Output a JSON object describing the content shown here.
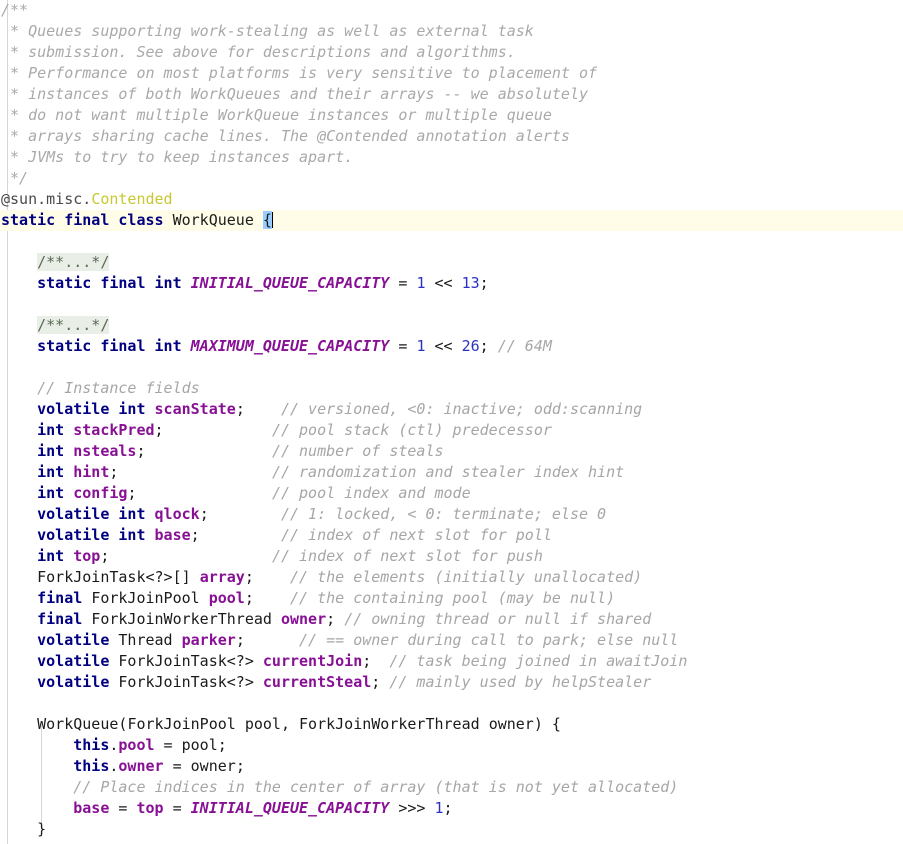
{
  "editor": {
    "language": "java",
    "theme": "light",
    "colors": {
      "background": "#ffffff",
      "current_line_highlight": "#fffce8",
      "keyword": "#000080",
      "field": "#871094",
      "constant": "#871094",
      "number": "#2a31c4",
      "comment": "#a6a6a6",
      "annotation_name": "#c8c832",
      "folded_region_bg": "#e9eee7",
      "matched_brace_bg": "#99ccff",
      "indent_guide": "#d6d6d6"
    },
    "caret_line_index": 9
  },
  "lines": [
    {
      "id": "line-1",
      "kind": "javadoc",
      "tokens": [
        {
          "cls": "jdoc",
          "t": "/**"
        }
      ]
    },
    {
      "id": "line-2",
      "kind": "javadoc",
      "tokens": [
        {
          "cls": "jdoc",
          "t": " * Queues supporting work-stealing as well as external task"
        }
      ]
    },
    {
      "id": "line-3",
      "kind": "javadoc",
      "tokens": [
        {
          "cls": "jdoc",
          "t": " * submission. See above for descriptions and algorithms."
        }
      ]
    },
    {
      "id": "line-4",
      "kind": "javadoc",
      "tokens": [
        {
          "cls": "jdoc",
          "t": " * Performance on most platforms is very sensitive to placement of"
        }
      ]
    },
    {
      "id": "line-5",
      "kind": "javadoc",
      "tokens": [
        {
          "cls": "jdoc",
          "t": " * instances of both WorkQueues and their arrays -- we absolutely"
        }
      ]
    },
    {
      "id": "line-6",
      "kind": "javadoc",
      "tokens": [
        {
          "cls": "jdoc",
          "t": " * do not want multiple WorkQueue instances or multiple queue"
        }
      ]
    },
    {
      "id": "line-7",
      "kind": "javadoc",
      "tokens": [
        {
          "cls": "jdoc",
          "t": " * arrays sharing cache lines. The @Contended annotation alerts"
        }
      ]
    },
    {
      "id": "line-8",
      "kind": "javadoc",
      "tokens": [
        {
          "cls": "jdoc",
          "t": " * JVMs to try to keep instances apart."
        }
      ]
    },
    {
      "id": "line-9",
      "kind": "javadoc",
      "tokens": [
        {
          "cls": "jdoc",
          "t": " */"
        }
      ]
    },
    {
      "id": "line-10",
      "kind": "annotation",
      "tokens": [
        {
          "cls": "anno",
          "t": "@sun.misc."
        },
        {
          "cls": "anno-name",
          "t": "Contended"
        }
      ]
    },
    {
      "id": "line-11",
      "kind": "class-declaration",
      "current": true,
      "tokens": [
        {
          "cls": "kw",
          "t": "static final class"
        },
        {
          "cls": "plain",
          "t": " "
        },
        {
          "cls": "type",
          "t": "WorkQueue"
        },
        {
          "cls": "plain",
          "t": " "
        },
        {
          "cls": "brace-hl",
          "t": "{"
        },
        {
          "cls": "caret",
          "t": ""
        }
      ]
    },
    {
      "id": "line-12",
      "kind": "blank",
      "tokens": [
        {
          "cls": "plain",
          "t": ""
        }
      ]
    },
    {
      "id": "line-13",
      "kind": "folded-javadoc",
      "tokens": [
        {
          "cls": "plain",
          "t": "    "
        },
        {
          "cls": "fold",
          "t": "/**...*/"
        }
      ]
    },
    {
      "id": "line-14",
      "kind": "constant-declaration",
      "tokens": [
        {
          "cls": "plain",
          "t": "    "
        },
        {
          "cls": "kw",
          "t": "static final int"
        },
        {
          "cls": "plain",
          "t": " "
        },
        {
          "cls": "constant",
          "t": "INITIAL_QUEUE_CAPACITY"
        },
        {
          "cls": "op",
          "t": " = "
        },
        {
          "cls": "num",
          "t": "1"
        },
        {
          "cls": "op",
          "t": " << "
        },
        {
          "cls": "num",
          "t": "13"
        },
        {
          "cls": "op",
          "t": ";"
        }
      ]
    },
    {
      "id": "line-15",
      "kind": "blank",
      "tokens": [
        {
          "cls": "plain",
          "t": ""
        }
      ]
    },
    {
      "id": "line-16",
      "kind": "folded-javadoc",
      "tokens": [
        {
          "cls": "plain",
          "t": "    "
        },
        {
          "cls": "fold",
          "t": "/**...*/"
        }
      ]
    },
    {
      "id": "line-17",
      "kind": "constant-declaration",
      "tokens": [
        {
          "cls": "plain",
          "t": "    "
        },
        {
          "cls": "kw",
          "t": "static final int"
        },
        {
          "cls": "plain",
          "t": " "
        },
        {
          "cls": "constant",
          "t": "MAXIMUM_QUEUE_CAPACITY"
        },
        {
          "cls": "op",
          "t": " = "
        },
        {
          "cls": "num",
          "t": "1"
        },
        {
          "cls": "op",
          "t": " << "
        },
        {
          "cls": "num",
          "t": "26"
        },
        {
          "cls": "op",
          "t": ";"
        },
        {
          "cls": "comment",
          "t": " // 64M"
        }
      ]
    },
    {
      "id": "line-18",
      "kind": "blank",
      "tokens": [
        {
          "cls": "plain",
          "t": ""
        }
      ]
    },
    {
      "id": "line-19",
      "kind": "comment",
      "tokens": [
        {
          "cls": "plain",
          "t": "    "
        },
        {
          "cls": "comment",
          "t": "// Instance fields"
        }
      ]
    },
    {
      "id": "line-20",
      "kind": "field-declaration",
      "tokens": [
        {
          "cls": "plain",
          "t": "    "
        },
        {
          "cls": "kw",
          "t": "volatile int"
        },
        {
          "cls": "plain",
          "t": " "
        },
        {
          "cls": "field",
          "t": "scanState"
        },
        {
          "cls": "op",
          "t": ";"
        },
        {
          "cls": "plain",
          "t": "    "
        },
        {
          "cls": "comment",
          "t": "// versioned, <0: inactive; odd:scanning"
        }
      ]
    },
    {
      "id": "line-21",
      "kind": "field-declaration",
      "tokens": [
        {
          "cls": "plain",
          "t": "    "
        },
        {
          "cls": "kw",
          "t": "int"
        },
        {
          "cls": "plain",
          "t": " "
        },
        {
          "cls": "field",
          "t": "stackPred"
        },
        {
          "cls": "op",
          "t": ";"
        },
        {
          "cls": "plain",
          "t": "            "
        },
        {
          "cls": "comment",
          "t": "// pool stack (ctl) predecessor"
        }
      ]
    },
    {
      "id": "line-22",
      "kind": "field-declaration",
      "tokens": [
        {
          "cls": "plain",
          "t": "    "
        },
        {
          "cls": "kw",
          "t": "int"
        },
        {
          "cls": "plain",
          "t": " "
        },
        {
          "cls": "field",
          "t": "nsteals"
        },
        {
          "cls": "op",
          "t": ";"
        },
        {
          "cls": "plain",
          "t": "              "
        },
        {
          "cls": "comment",
          "t": "// number of steals"
        }
      ]
    },
    {
      "id": "line-23",
      "kind": "field-declaration",
      "tokens": [
        {
          "cls": "plain",
          "t": "    "
        },
        {
          "cls": "kw",
          "t": "int"
        },
        {
          "cls": "plain",
          "t": " "
        },
        {
          "cls": "field",
          "t": "hint"
        },
        {
          "cls": "op",
          "t": ";"
        },
        {
          "cls": "plain",
          "t": "                 "
        },
        {
          "cls": "comment",
          "t": "// randomization and stealer index hint"
        }
      ]
    },
    {
      "id": "line-24",
      "kind": "field-declaration",
      "tokens": [
        {
          "cls": "plain",
          "t": "    "
        },
        {
          "cls": "kw",
          "t": "int"
        },
        {
          "cls": "plain",
          "t": " "
        },
        {
          "cls": "field",
          "t": "config"
        },
        {
          "cls": "op",
          "t": ";"
        },
        {
          "cls": "plain",
          "t": "               "
        },
        {
          "cls": "comment",
          "t": "// pool index and mode"
        }
      ]
    },
    {
      "id": "line-25",
      "kind": "field-declaration",
      "tokens": [
        {
          "cls": "plain",
          "t": "    "
        },
        {
          "cls": "kw",
          "t": "volatile int"
        },
        {
          "cls": "plain",
          "t": " "
        },
        {
          "cls": "field",
          "t": "qlock"
        },
        {
          "cls": "op",
          "t": ";"
        },
        {
          "cls": "plain",
          "t": "        "
        },
        {
          "cls": "comment",
          "t": "// 1: locked, < 0: terminate; else 0"
        }
      ]
    },
    {
      "id": "line-26",
      "kind": "field-declaration",
      "tokens": [
        {
          "cls": "plain",
          "t": "    "
        },
        {
          "cls": "kw",
          "t": "volatile int"
        },
        {
          "cls": "plain",
          "t": " "
        },
        {
          "cls": "field",
          "t": "base"
        },
        {
          "cls": "op",
          "t": ";"
        },
        {
          "cls": "plain",
          "t": "         "
        },
        {
          "cls": "comment",
          "t": "// index of next slot for poll"
        }
      ]
    },
    {
      "id": "line-27",
      "kind": "field-declaration",
      "tokens": [
        {
          "cls": "plain",
          "t": "    "
        },
        {
          "cls": "kw",
          "t": "int"
        },
        {
          "cls": "plain",
          "t": " "
        },
        {
          "cls": "field",
          "t": "top"
        },
        {
          "cls": "op",
          "t": ";"
        },
        {
          "cls": "plain",
          "t": "                  "
        },
        {
          "cls": "comment",
          "t": "// index of next slot for push"
        }
      ]
    },
    {
      "id": "line-28",
      "kind": "field-declaration",
      "tokens": [
        {
          "cls": "plain",
          "t": "    "
        },
        {
          "cls": "type",
          "t": "ForkJoinTask<?>[]"
        },
        {
          "cls": "plain",
          "t": " "
        },
        {
          "cls": "field",
          "t": "array"
        },
        {
          "cls": "op",
          "t": ";"
        },
        {
          "cls": "plain",
          "t": "    "
        },
        {
          "cls": "comment",
          "t": "// the elements (initially unallocated)"
        }
      ]
    },
    {
      "id": "line-29",
      "kind": "field-declaration",
      "tokens": [
        {
          "cls": "plain",
          "t": "    "
        },
        {
          "cls": "kw",
          "t": "final"
        },
        {
          "cls": "plain",
          "t": " "
        },
        {
          "cls": "type",
          "t": "ForkJoinPool"
        },
        {
          "cls": "plain",
          "t": " "
        },
        {
          "cls": "field",
          "t": "pool"
        },
        {
          "cls": "op",
          "t": ";"
        },
        {
          "cls": "plain",
          "t": "    "
        },
        {
          "cls": "comment",
          "t": "// the containing pool (may be null)"
        }
      ]
    },
    {
      "id": "line-30",
      "kind": "field-declaration",
      "tokens": [
        {
          "cls": "plain",
          "t": "    "
        },
        {
          "cls": "kw",
          "t": "final"
        },
        {
          "cls": "plain",
          "t": " "
        },
        {
          "cls": "type",
          "t": "ForkJoinWorkerThread"
        },
        {
          "cls": "plain",
          "t": " "
        },
        {
          "cls": "field",
          "t": "owner"
        },
        {
          "cls": "op",
          "t": ";"
        },
        {
          "cls": "plain",
          "t": " "
        },
        {
          "cls": "comment",
          "t": "// owning thread or null if shared"
        }
      ]
    },
    {
      "id": "line-31",
      "kind": "field-declaration",
      "tokens": [
        {
          "cls": "plain",
          "t": "    "
        },
        {
          "cls": "kw",
          "t": "volatile"
        },
        {
          "cls": "plain",
          "t": " "
        },
        {
          "cls": "type",
          "t": "Thread"
        },
        {
          "cls": "plain",
          "t": " "
        },
        {
          "cls": "field",
          "t": "parker"
        },
        {
          "cls": "op",
          "t": ";"
        },
        {
          "cls": "plain",
          "t": "      "
        },
        {
          "cls": "comment",
          "t": "// == owner during call to park; else null"
        }
      ]
    },
    {
      "id": "line-32",
      "kind": "field-declaration",
      "tokens": [
        {
          "cls": "plain",
          "t": "    "
        },
        {
          "cls": "kw",
          "t": "volatile"
        },
        {
          "cls": "plain",
          "t": " "
        },
        {
          "cls": "type",
          "t": "ForkJoinTask<?>"
        },
        {
          "cls": "plain",
          "t": " "
        },
        {
          "cls": "field",
          "t": "currentJoin"
        },
        {
          "cls": "op",
          "t": ";"
        },
        {
          "cls": "plain",
          "t": "  "
        },
        {
          "cls": "comment",
          "t": "// task being joined in awaitJoin"
        }
      ]
    },
    {
      "id": "line-33",
      "kind": "field-declaration",
      "tokens": [
        {
          "cls": "plain",
          "t": "    "
        },
        {
          "cls": "kw",
          "t": "volatile"
        },
        {
          "cls": "plain",
          "t": " "
        },
        {
          "cls": "type",
          "t": "ForkJoinTask<?>"
        },
        {
          "cls": "plain",
          "t": " "
        },
        {
          "cls": "field",
          "t": "currentSteal"
        },
        {
          "cls": "op",
          "t": ";"
        },
        {
          "cls": "plain",
          "t": " "
        },
        {
          "cls": "comment",
          "t": "// mainly used by helpStealer"
        }
      ]
    },
    {
      "id": "line-34",
      "kind": "blank",
      "tokens": [
        {
          "cls": "plain",
          "t": ""
        }
      ]
    },
    {
      "id": "line-35",
      "kind": "constructor-signature",
      "tokens": [
        {
          "cls": "plain",
          "t": "    "
        },
        {
          "cls": "type",
          "t": "WorkQueue"
        },
        {
          "cls": "op",
          "t": "("
        },
        {
          "cls": "type",
          "t": "ForkJoinPool"
        },
        {
          "cls": "plain",
          "t": " "
        },
        {
          "cls": "plain",
          "t": "pool"
        },
        {
          "cls": "op",
          "t": ", "
        },
        {
          "cls": "type",
          "t": "ForkJoinWorkerThread"
        },
        {
          "cls": "plain",
          "t": " "
        },
        {
          "cls": "plain",
          "t": "owner"
        },
        {
          "cls": "op",
          "t": ") {"
        }
      ]
    },
    {
      "id": "line-36",
      "kind": "statement",
      "tokens": [
        {
          "cls": "plain",
          "t": "        "
        },
        {
          "cls": "kw",
          "t": "this"
        },
        {
          "cls": "op",
          "t": "."
        },
        {
          "cls": "field",
          "t": "pool"
        },
        {
          "cls": "op",
          "t": " = "
        },
        {
          "cls": "plain",
          "t": "pool"
        },
        {
          "cls": "op",
          "t": ";"
        }
      ]
    },
    {
      "id": "line-37",
      "kind": "statement",
      "tokens": [
        {
          "cls": "plain",
          "t": "        "
        },
        {
          "cls": "kw",
          "t": "this"
        },
        {
          "cls": "op",
          "t": "."
        },
        {
          "cls": "field",
          "t": "owner"
        },
        {
          "cls": "op",
          "t": " = "
        },
        {
          "cls": "plain",
          "t": "owner"
        },
        {
          "cls": "op",
          "t": ";"
        }
      ]
    },
    {
      "id": "line-38",
      "kind": "comment",
      "tokens": [
        {
          "cls": "plain",
          "t": "        "
        },
        {
          "cls": "comment",
          "t": "// Place indices in the center of array (that is not yet allocated)"
        }
      ]
    },
    {
      "id": "line-39",
      "kind": "statement",
      "tokens": [
        {
          "cls": "plain",
          "t": "        "
        },
        {
          "cls": "field",
          "t": "base"
        },
        {
          "cls": "op",
          "t": " = "
        },
        {
          "cls": "field",
          "t": "top"
        },
        {
          "cls": "op",
          "t": " = "
        },
        {
          "cls": "constant",
          "t": "INITIAL_QUEUE_CAPACITY"
        },
        {
          "cls": "op",
          "t": " >>> "
        },
        {
          "cls": "num",
          "t": "1"
        },
        {
          "cls": "op",
          "t": ";"
        }
      ]
    },
    {
      "id": "line-40",
      "kind": "closing-brace",
      "tokens": [
        {
          "cls": "plain",
          "t": "    "
        },
        {
          "cls": "op",
          "t": "}"
        }
      ]
    }
  ]
}
